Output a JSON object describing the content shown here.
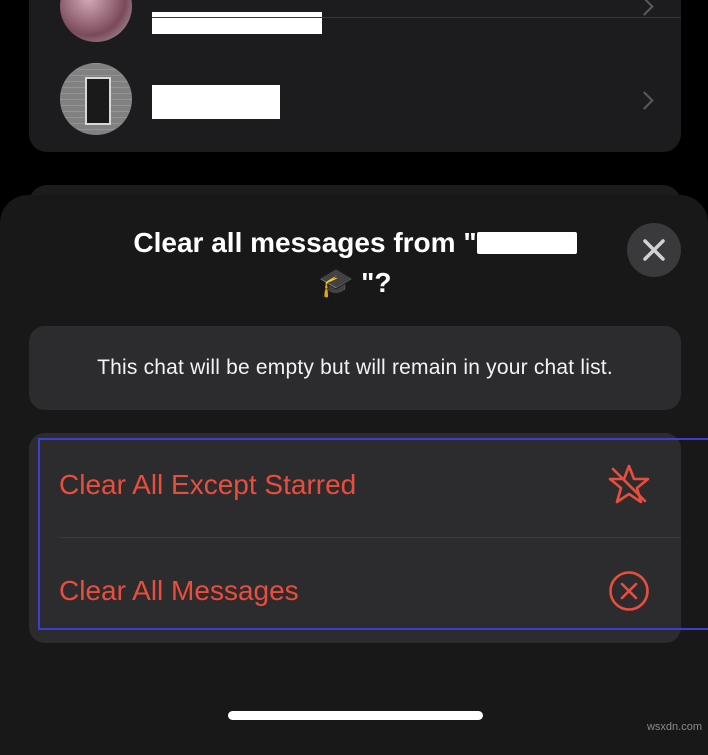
{
  "chat_list": {
    "rows": [
      {
        "name": "",
        "chevron": "chevron-right-icon"
      },
      {
        "name": "",
        "chevron": "chevron-right-icon"
      }
    ]
  },
  "sheet": {
    "title_prefix": "Clear all messages from \"",
    "title_suffix": "🎓 \"?",
    "close_icon": "close-icon",
    "info_text": "This chat will be empty but will remain in your chat list.",
    "options": [
      {
        "label": "Clear All Except Starred",
        "icon": "star-slash-icon"
      },
      {
        "label": "Clear All Messages",
        "icon": "x-circle-icon"
      }
    ]
  },
  "watermark": "wsxdn.com",
  "colors": {
    "destructive": "#eb4d3d",
    "sheet_bg": "#181818",
    "card_bg": "#2c2c2e",
    "highlight": "#3b3fcf"
  }
}
